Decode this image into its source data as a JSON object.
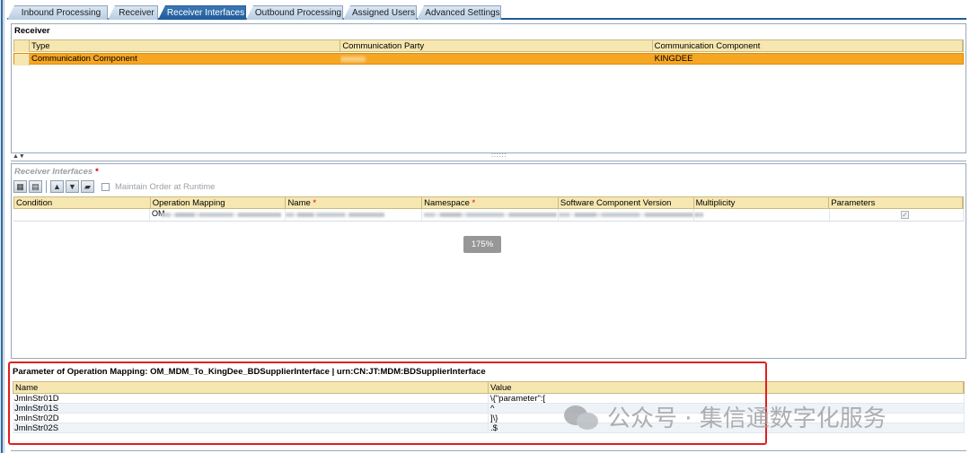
{
  "tabs": [
    {
      "label": "Inbound Processing"
    },
    {
      "label": "Receiver"
    },
    {
      "label": "Receiver Interfaces"
    },
    {
      "label": "Outbound Processing"
    },
    {
      "label": "Assigned Users"
    },
    {
      "label": "Advanced Settings"
    }
  ],
  "receiver": {
    "title": "Receiver",
    "columns": [
      "Type",
      "Communication Party",
      "Communication Component"
    ],
    "row": {
      "type": "Communication Component",
      "party": "",
      "component": "KINGDEE"
    }
  },
  "interfaces": {
    "title": "Receiver Interfaces",
    "required_mark": "*",
    "maintain_label": "Maintain Order at Runtime",
    "columns": {
      "condition": "Condition",
      "operation_mapping": "Operation Mapping",
      "name": "Name",
      "namespace": "Namespace",
      "swcv": "Software Component Version",
      "multiplicity": "Multiplicity",
      "parameters": "Parameters"
    },
    "row": {
      "operation_mapping_prefix": "OM",
      "parameters_checked": true
    },
    "zoom": "175%"
  },
  "parameters": {
    "title": "Parameter of Operation Mapping: OM_MDM_To_KingDee_BDSupplierInterface | urn:CN:JT:MDM:BDSupplierInterface",
    "columns": [
      "Name",
      "Value"
    ],
    "rows": [
      {
        "name": "JmlnStr01D",
        "value": "\\{\"parameter\":["
      },
      {
        "name": "JmlnStr01S",
        "value": "^"
      },
      {
        "name": "JmlnStr02D",
        "value": "]\\}"
      },
      {
        "name": "JmlnStr02S",
        "value": ".$"
      }
    ]
  },
  "watermark": {
    "text": "公众号 · 集信通数字化服务"
  }
}
